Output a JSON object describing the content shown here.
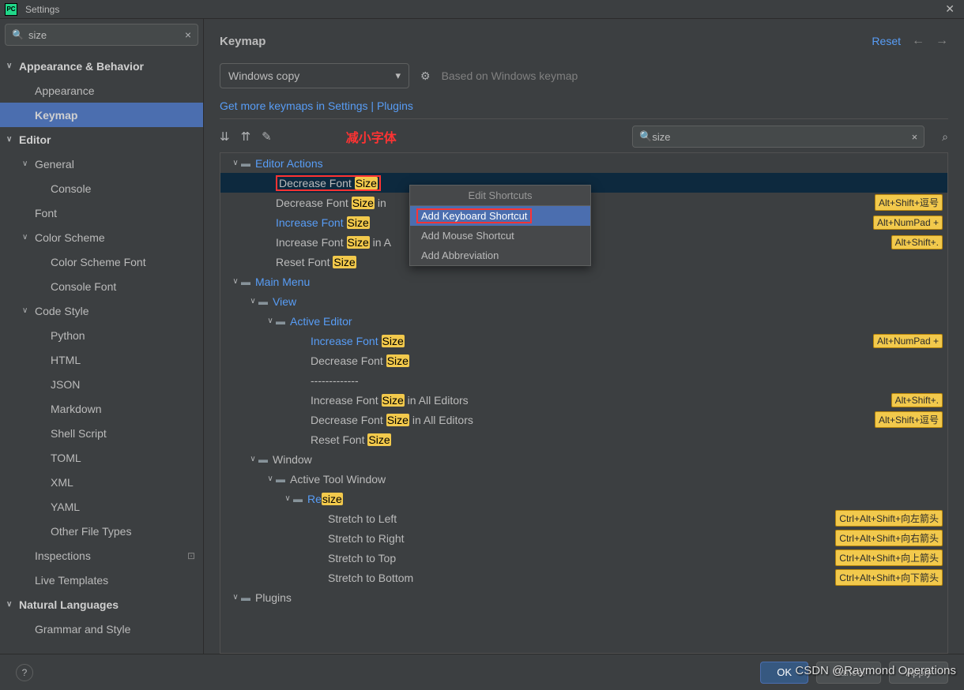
{
  "window": {
    "title": "Settings"
  },
  "sidebar": {
    "search": "size",
    "items": [
      {
        "label": "Appearance & Behavior",
        "chev": "∨",
        "bold": true,
        "cls": ""
      },
      {
        "label": "Appearance",
        "cls": "indent1"
      },
      {
        "label": "Keymap",
        "cls": "indent1",
        "selected": true,
        "bold": true
      },
      {
        "label": "Editor",
        "chev": "∨",
        "bold": true,
        "cls": ""
      },
      {
        "label": "General",
        "chev": "∨",
        "cls": "indent1"
      },
      {
        "label": "Console",
        "cls": "indent2"
      },
      {
        "label": "Font",
        "cls": "indent1"
      },
      {
        "label": "Color Scheme",
        "chev": "∨",
        "cls": "indent1"
      },
      {
        "label": "Color Scheme Font",
        "cls": "indent2"
      },
      {
        "label": "Console Font",
        "cls": "indent2"
      },
      {
        "label": "Code Style",
        "chev": "∨",
        "cls": "indent1"
      },
      {
        "label": "Python",
        "cls": "indent2"
      },
      {
        "label": "HTML",
        "cls": "indent2"
      },
      {
        "label": "JSON",
        "cls": "indent2"
      },
      {
        "label": "Markdown",
        "cls": "indent2"
      },
      {
        "label": "Shell Script",
        "cls": "indent2"
      },
      {
        "label": "TOML",
        "cls": "indent2"
      },
      {
        "label": "XML",
        "cls": "indent2"
      },
      {
        "label": "YAML",
        "cls": "indent2"
      },
      {
        "label": "Other File Types",
        "cls": "indent2"
      },
      {
        "label": "Inspections",
        "cls": "indent1",
        "gear": true
      },
      {
        "label": "Live Templates",
        "cls": "indent1"
      },
      {
        "label": "Natural Languages",
        "chev": "∨",
        "bold": true,
        "cls": ""
      },
      {
        "label": "Grammar and Style",
        "cls": "indent1"
      }
    ]
  },
  "content": {
    "title": "Keymap",
    "reset": "Reset",
    "dropdown": "Windows copy",
    "based": "Based on Windows keymap",
    "link": "Get more keymaps in Settings | Plugins",
    "annotation": "减小字体",
    "action_search": "size"
  },
  "actions": [
    {
      "pad": "pl1",
      "chev": "∨",
      "folder": "📁",
      "pre": "",
      "hl": "",
      "post": "Editor Actions",
      "blue": true
    },
    {
      "pad": "pl3",
      "pre": "Decrease Font ",
      "hl": "Size",
      "post": "",
      "selected": true,
      "redbox": true
    },
    {
      "pad": "pl3",
      "pre": "Decrease Font ",
      "hl": "Size",
      "post": " in",
      "shortcut": "Alt+Shift+逗号"
    },
    {
      "pad": "pl3",
      "pre": "Increase Font ",
      "hl": "Size",
      "post": "",
      "blue": true,
      "shortcut": "Alt+NumPad +"
    },
    {
      "pad": "pl3",
      "pre": "Increase Font ",
      "hl": "Size",
      "post": " in A",
      "shortcut": "Alt+Shift+."
    },
    {
      "pad": "pl3",
      "pre": "Reset Font ",
      "hl": "Size",
      "post": ""
    },
    {
      "pad": "pl1",
      "chev": "∨",
      "folder": "📁",
      "pre": "",
      "hl": "",
      "post": "Main Menu",
      "blue": true
    },
    {
      "pad": "pl2",
      "chev": "∨",
      "folder": "📁",
      "pre": "",
      "hl": "",
      "post": "View",
      "blue": true
    },
    {
      "pad": "pl3",
      "chev": "∨",
      "folder": "📁",
      "pre": "",
      "hl": "",
      "post": "Active Editor",
      "blue": true
    },
    {
      "pad": "pl5",
      "pre": "Increase Font ",
      "hl": "Size",
      "post": "",
      "blue": true,
      "shortcut": "Alt+NumPad +"
    },
    {
      "pad": "pl5",
      "pre": "Decrease Font ",
      "hl": "Size",
      "post": ""
    },
    {
      "pad": "pl5",
      "pre": "-------------",
      "hl": "",
      "post": ""
    },
    {
      "pad": "pl5",
      "pre": "Increase Font ",
      "hl": "Size",
      "post": " in All Editors",
      "shortcut": "Alt+Shift+."
    },
    {
      "pad": "pl5",
      "pre": "Decrease Font ",
      "hl": "Size",
      "post": " in All Editors",
      "shortcut": "Alt+Shift+逗号"
    },
    {
      "pad": "pl5",
      "pre": "Reset Font ",
      "hl": "Size",
      "post": ""
    },
    {
      "pad": "pl2",
      "chev": "∨",
      "folder": "📁",
      "pre": "",
      "hl": "",
      "post": "Window"
    },
    {
      "pad": "pl3",
      "chev": "∨",
      "folder": "📁",
      "pre": "",
      "hl": "",
      "post": "Active Tool Window"
    },
    {
      "pad": "pl4",
      "chev": "∨",
      "folder": "📁",
      "pre": "Re",
      "hl": "size",
      "post": "",
      "blue": true
    },
    {
      "pad": "pl6",
      "pre": "Stretch to Left",
      "hl": "",
      "post": "",
      "shortcut": "Ctrl+Alt+Shift+向左箭头"
    },
    {
      "pad": "pl6",
      "pre": "Stretch to Right",
      "hl": "",
      "post": "",
      "shortcut": "Ctrl+Alt+Shift+向右箭头"
    },
    {
      "pad": "pl6",
      "pre": "Stretch to Top",
      "hl": "",
      "post": "",
      "shortcut": "Ctrl+Alt+Shift+向上箭头"
    },
    {
      "pad": "pl6",
      "pre": "Stretch to Bottom",
      "hl": "",
      "post": "",
      "shortcut": "Ctrl+Alt+Shift+向下箭头"
    },
    {
      "pad": "pl1",
      "chev": "∨",
      "folder": "📁",
      "pre": "",
      "hl": "",
      "post": "Plugins"
    }
  ],
  "ctx": {
    "header": "Edit Shortcuts",
    "items": [
      "Add Keyboard Shortcut",
      "Add Mouse Shortcut",
      "Add Abbreviation"
    ]
  },
  "footer": {
    "ok": "OK",
    "cancel": "Cancel",
    "apply": "Apply"
  },
  "watermark": "CSDN @Raymond Operations"
}
